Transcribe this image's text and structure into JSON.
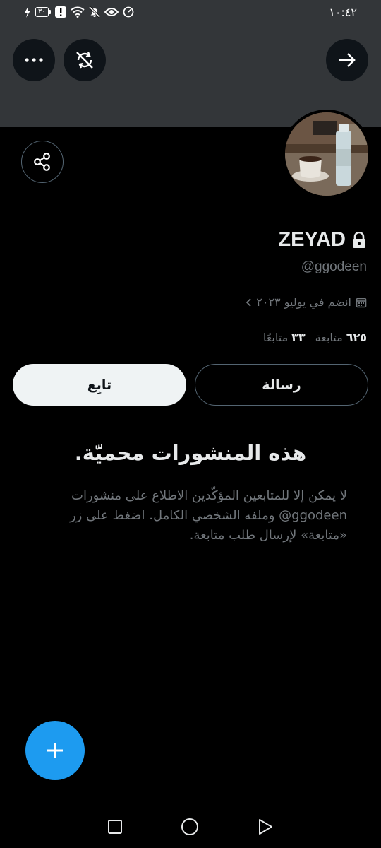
{
  "status_bar": {
    "time": "١٠:٤٢",
    "battery_level": "٣٠",
    "icons": [
      "charging-icon",
      "battery-icon",
      "alert-icon",
      "wifi-icon",
      "mute-icon",
      "eye-icon",
      "speed-icon"
    ]
  },
  "header": {
    "actions": [
      "more-icon",
      "sync-off-icon",
      "arrow-right-icon"
    ]
  },
  "profile": {
    "display_name": "ZEYAD",
    "handle": "@ggodeen",
    "joined": "انضم في يوليو ٢٠٢٣",
    "following_count": "٦٢٥",
    "following_label": "متابعة",
    "followers_count": "٣٣",
    "followers_label": "متابعًا",
    "locked": true
  },
  "actions": {
    "message_label": "رسالة",
    "follow_label": "تابِع"
  },
  "protected": {
    "title": "هذه المنشورات محميّة.",
    "description": "لا يمكن إلا للمتابعين المؤكّدين الاطلاع على منشورات ggodeen@ وملفه الشخصي الكامل. اضغط على زر «متابعة» لإرسال طلب متابعة."
  },
  "colors": {
    "accent": "#1d9bf0",
    "banner": "#333639",
    "background": "#000000",
    "secondary_text": "#71767b"
  }
}
